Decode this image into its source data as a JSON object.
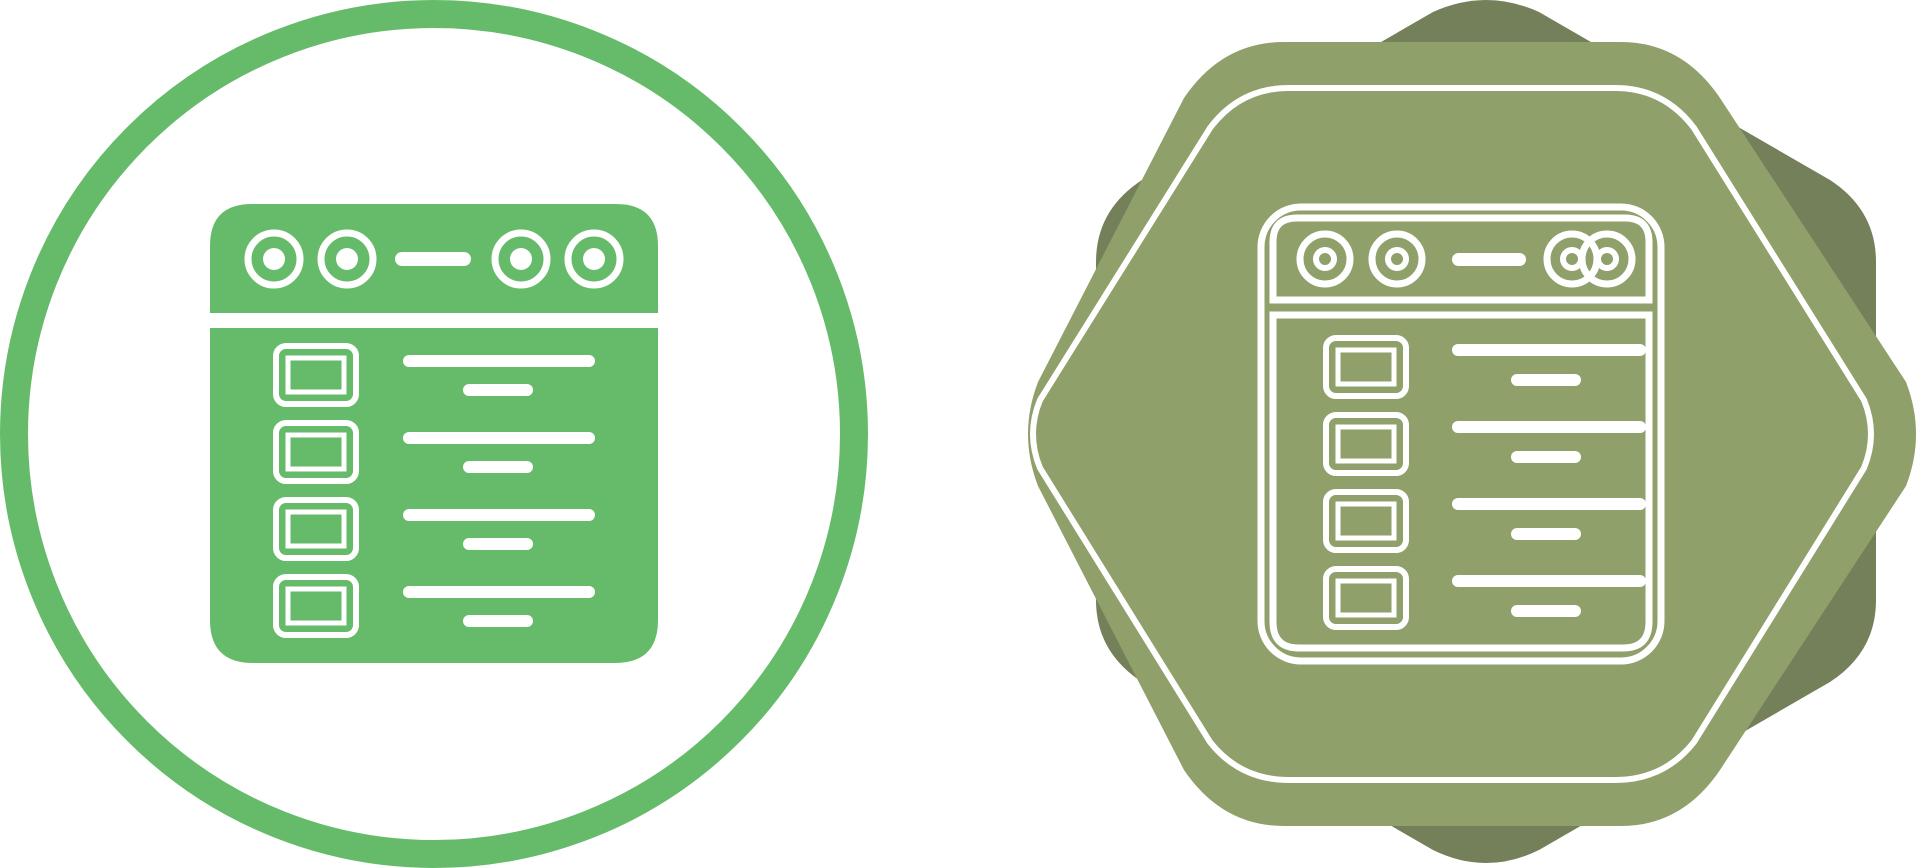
{
  "icons": [
    {
      "variant": "glyph-in-circle",
      "depicts": "browser-window-list-icon",
      "colors": {
        "ring": "#66BB6A",
        "glyph": "#66BB6A",
        "detail": "#FFFFFF",
        "background": "#FFFFFF"
      },
      "list_rows": 4,
      "window_controls": 4
    },
    {
      "variant": "outline-on-badge",
      "depicts": "browser-window-list-icon",
      "colors": {
        "badge_shadow": "#74805A",
        "badge": "#8FA06A",
        "outline": "#FFFFFF"
      },
      "list_rows": 4,
      "window_controls": 4
    }
  ]
}
